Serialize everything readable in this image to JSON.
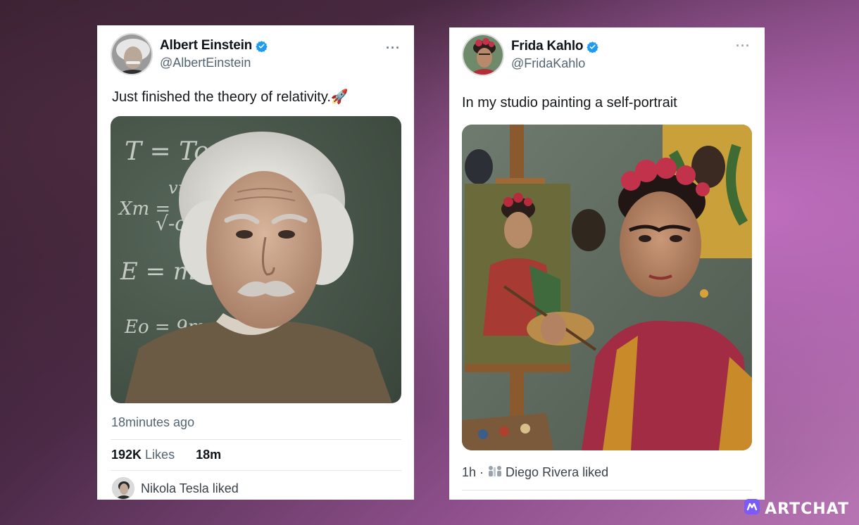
{
  "tweets": [
    {
      "display_name": "Albert Einstein",
      "handle": "@AlbertEinstein",
      "text": "Just finished the theory of relativity.",
      "text_emoji": "🚀",
      "media_equations": [
        "T = To",
        "vm",
        "Xm =",
        "√-c²",
        "E = mc²",
        "Eo = 9m..."
      ],
      "timestamp": "18minutes ago",
      "likes_count": "192K",
      "likes_label": "Likes",
      "time_short": "18m",
      "liked_by": "Nikola Tesla liked"
    },
    {
      "display_name": "Frida Kahlo",
      "handle": "@FridaKahlo",
      "text": "In my studio painting a self-portrait",
      "time": "1h",
      "separator": "·",
      "liked_by": "Diego Rivera liked"
    }
  ],
  "icons": {
    "verified": "verified-badge-icon",
    "more": "more-options-icon",
    "people": "people-icon",
    "rocket": "rocket-emoji",
    "brand": "artchat-logo-icon"
  },
  "more_glyph": "···",
  "brand": {
    "name": "ARTCHAT"
  },
  "colors": {
    "verified": "#1d9bf0",
    "secondary_text": "#536471",
    "chalkboard": "#4a5847",
    "brand_logo": "#7a5af8"
  }
}
